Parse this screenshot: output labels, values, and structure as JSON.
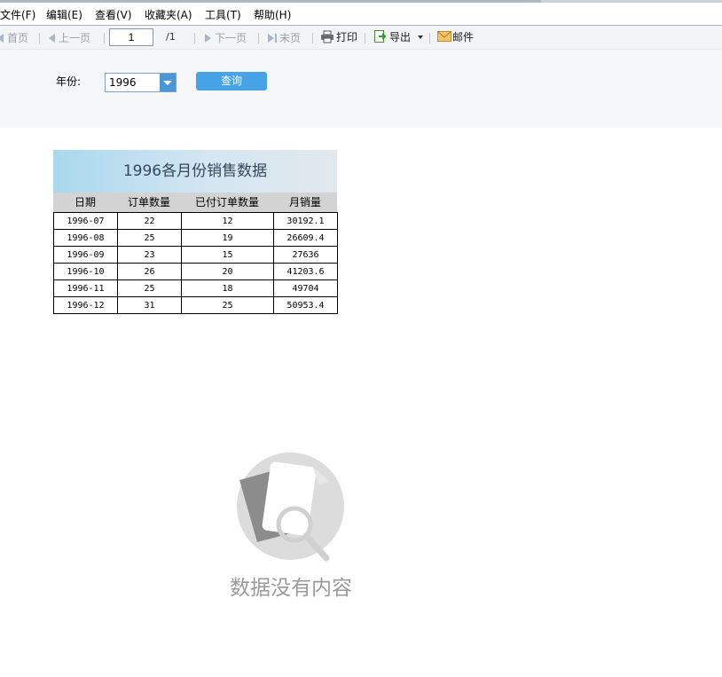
{
  "menu": [
    "文件(F)",
    "编辑(E)",
    "查看(V)",
    "收藏夹(A)",
    "工具(T)",
    "帮助(H)"
  ],
  "toolbar": {
    "first": "首页",
    "prev": "上一页",
    "page_value": "1",
    "page_total": "/1",
    "next": "下一页",
    "last": "末页",
    "print": "打印",
    "export": "导出",
    "email": "邮件"
  },
  "query": {
    "year_label": "年份:",
    "year_value": "1996",
    "button": "查询"
  },
  "report": {
    "title": "1996各月份销售数据",
    "columns": [
      "日期",
      "订单数量",
      "已付订单数量",
      "月销量"
    ],
    "rows": [
      [
        "1996-07",
        "22",
        "12",
        "30192.1"
      ],
      [
        "1996-08",
        "25",
        "19",
        "26609.4"
      ],
      [
        "1996-09",
        "23",
        "15",
        "27636"
      ],
      [
        "1996-10",
        "26",
        "20",
        "41203.6"
      ],
      [
        "1996-11",
        "25",
        "18",
        "49704"
      ],
      [
        "1996-12",
        "31",
        "25",
        "50953.4"
      ]
    ]
  },
  "empty_state": {
    "text": "数据没有内容",
    "icon": "document-search-icon"
  }
}
